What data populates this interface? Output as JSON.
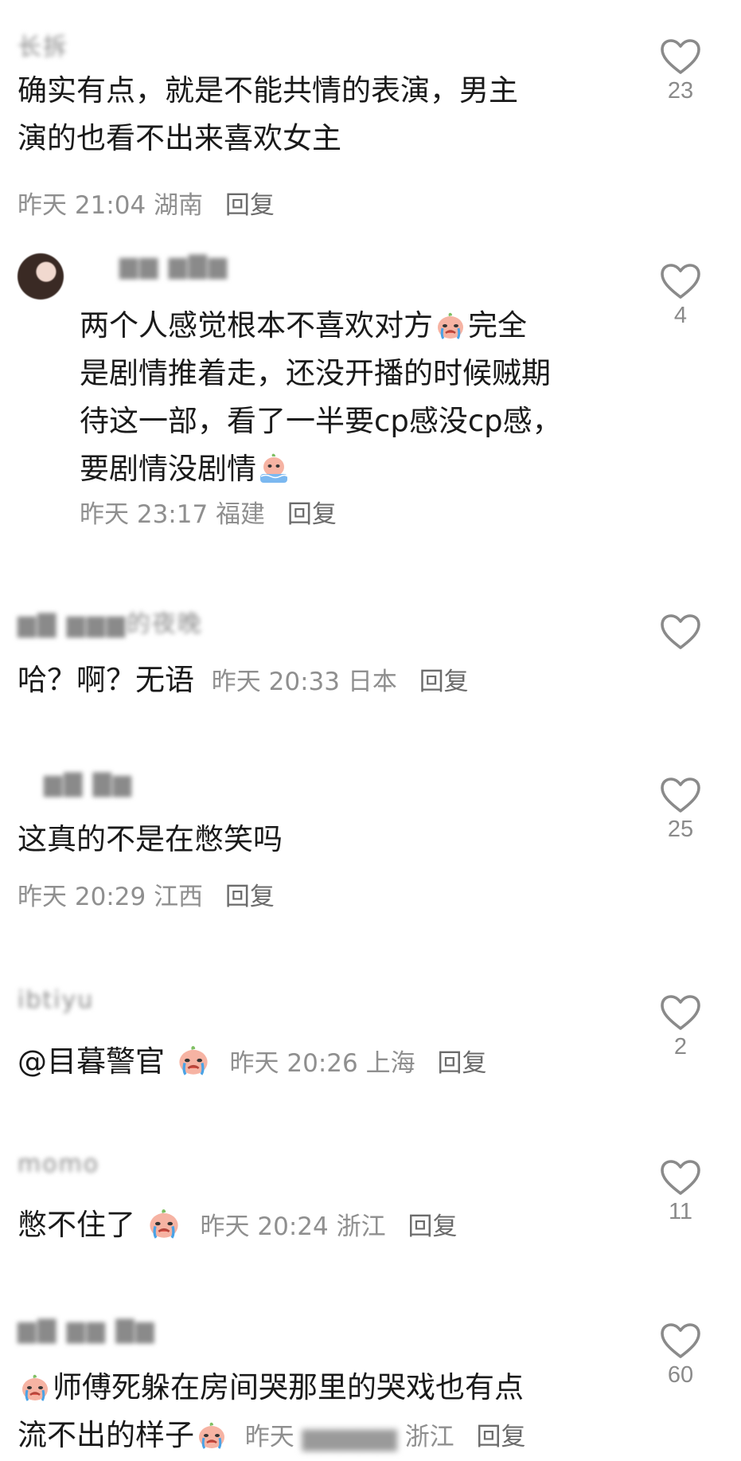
{
  "comments": [
    {
      "username": "长拆",
      "lines": [
        "确实有点，就是不能共情的表演，男主",
        "演的也看不出来喜欢女主"
      ],
      "time": "昨天 21:04",
      "location": "湖南",
      "reply": "回复",
      "likes": "23"
    },
    {
      "username": "",
      "lines": [
        "两个人感觉根本不喜欢对方",
        "完全",
        "是剧情推着走，还没开播的时候贼期",
        "待这一部，看了一半要cp感没cp感，",
        "要剧情没剧情"
      ],
      "time": "昨天 23:17",
      "location": "福建",
      "reply": "回复",
      "likes": "4"
    },
    {
      "username": "的夜晚",
      "text": "哈？啊？无语",
      "time": "昨天 20:33",
      "location": "日本",
      "reply": "回复",
      "likes": ""
    },
    {
      "username": "",
      "text": "这真的不是在憋笑吗",
      "time": "昨天 20:29",
      "location": "江西",
      "reply": "回复",
      "likes": "25"
    },
    {
      "username": "ibtiyu",
      "text": "@目暮警官",
      "time": "昨天 20:26",
      "location": "上海",
      "reply": "回复",
      "likes": "2"
    },
    {
      "username": "momo",
      "text": "憋不住了",
      "time": "昨天 20:24",
      "location": "浙江",
      "reply": "回复",
      "likes": "11"
    },
    {
      "username": "",
      "lines": [
        "师傅死躲在房间哭那里的哭戏也有点",
        "流不出的样子"
      ],
      "time": "昨天",
      "location": "浙江",
      "reply": "回复",
      "likes": "60"
    }
  ],
  "icons": {
    "like": "heart-outline-icon",
    "emoji": "crying-peach-emoji-icon"
  },
  "colors": {
    "text": "#1a1a1a",
    "meta": "#8f8f8f",
    "heart": "#8a8a8a"
  }
}
